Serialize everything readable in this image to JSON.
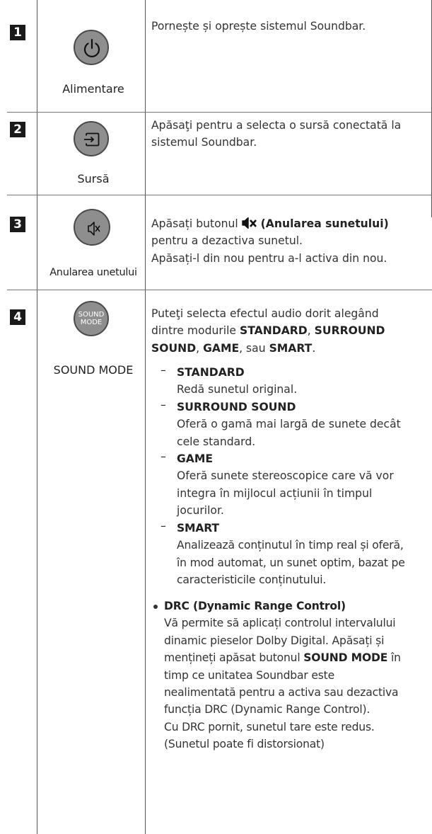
{
  "rows": [
    {
      "number": "1",
      "button_icon": "power-icon",
      "button_label": "Alimentare",
      "description": "Pornește și oprește sistemul Soundbar."
    },
    {
      "number": "2",
      "button_icon": "source-input-icon",
      "button_label": "Sursă",
      "description_lines": [
        "Apăsaţi pentru a selecta o sursă conectată la",
        "sistemul Soundbar."
      ]
    },
    {
      "number": "3",
      "button_icon": "mute-speaker-icon",
      "button_label": "Anularea unetului",
      "desc_prefix": "Apăsați butonul ",
      "desc_bold": "(Anularea sunetului)",
      "desc_line2": "pentru a dezactiva sunetul.",
      "desc_line3": "Apăsați-l din nou pentru a-l activa din nou."
    },
    {
      "number": "4",
      "button_text_top": "SOUND",
      "button_text_bottom": "MODE",
      "button_label": "SOUND MODE",
      "intro_1": "Puteţi selecta efectul audio dorit alegând",
      "intro_2a": "dintre modurile ",
      "intro_2b": "STANDARD",
      "intro_2c": ", ",
      "intro_2d": "SURROUND",
      "intro_3a": "SOUND",
      "intro_3b": ", ",
      "intro_3c": "GAME",
      "intro_3d": ", sau ",
      "intro_3e": "SMART",
      "intro_3f": ".",
      "modes": [
        {
          "dash": "–",
          "title": "STANDARD",
          "lines": [
            "Redă sunetul original."
          ]
        },
        {
          "dash": "–",
          "title": "SURROUND SOUND",
          "lines": [
            "Oferă o gamă mai largă de sunete decât",
            "cele standard."
          ]
        },
        {
          "dash": "–",
          "title": "GAME",
          "lines": [
            "Oferă sunete stereoscopice care vă vor",
            "integra în mijlocul acțiunii în timpul",
            "jocurilor."
          ]
        },
        {
          "dash": "–",
          "title": "SMART",
          "lines": [
            "Analizează conținutul în timp real și oferă,",
            "în mod automat, un sunet optim, bazat pe",
            "caracteristicile conținutului."
          ]
        }
      ],
      "drc_title": "DRC (Dynamic Range Control)",
      "drc_1": "Vă permite să aplicați controlul intervalului",
      "drc_2": "dinamic pieselor Dolby Digital. Apăsați și",
      "drc_3a": "mențineți apăsat butonul ",
      "drc_3b": "SOUND MODE",
      "drc_3c": " în",
      "drc_4": "timp ce unitatea Soundbar este",
      "drc_5": "nealimentată pentru a activa sau dezactiva",
      "drc_6": "funcția DRC (Dynamic Range Control).",
      "drc_7": "Cu DRC pornit, sunetul tare este redus.",
      "drc_8": "(Sunetul poate fi distorsionat)"
    }
  ]
}
